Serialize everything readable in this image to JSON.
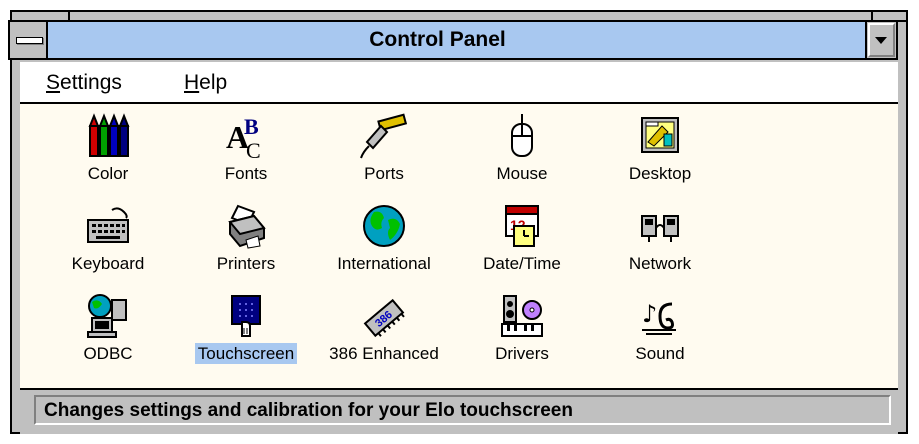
{
  "window": {
    "title": "Control Panel"
  },
  "menubar": {
    "items": [
      {
        "accel": "S",
        "rest": "ettings"
      },
      {
        "accel": "H",
        "rest": "elp"
      }
    ]
  },
  "icons": [
    {
      "label": "Color",
      "icon": "color-icon"
    },
    {
      "label": "Fonts",
      "icon": "fonts-icon"
    },
    {
      "label": "Ports",
      "icon": "ports-icon"
    },
    {
      "label": "Mouse",
      "icon": "mouse-icon"
    },
    {
      "label": "Desktop",
      "icon": "desktop-icon"
    },
    {
      "label": "Keyboard",
      "icon": "keyboard-icon"
    },
    {
      "label": "Printers",
      "icon": "printer-icon"
    },
    {
      "label": "International",
      "icon": "globe-icon"
    },
    {
      "label": "Date/Time",
      "icon": "calendar-clock-icon"
    },
    {
      "label": "Network",
      "icon": "network-icon"
    },
    {
      "label": "ODBC",
      "icon": "odbc-icon"
    },
    {
      "label": "Touchscreen",
      "icon": "touchscreen-icon",
      "selected": true
    },
    {
      "label": "386 Enhanced",
      "icon": "chip-icon"
    },
    {
      "label": "Drivers",
      "icon": "drivers-icon"
    },
    {
      "label": "Sound",
      "icon": "sound-icon"
    }
  ],
  "statusbar": {
    "text": "Changes settings and calibration for your Elo touchscreen"
  },
  "colors": {
    "titlebar": "#a8c8f0",
    "selection": "#a8c8f0",
    "client_bg": "#fffbf0",
    "chrome": "#c0c0c0"
  }
}
